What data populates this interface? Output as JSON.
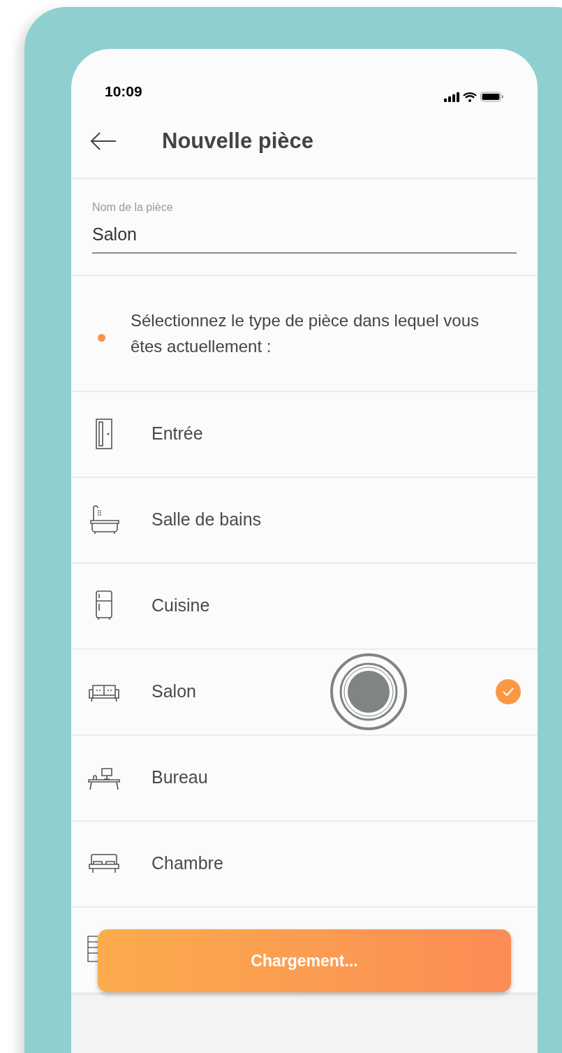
{
  "status_bar": {
    "time": "10:09"
  },
  "header": {
    "title": "Nouvelle pièce"
  },
  "name_field": {
    "label": "Nom de la pièce",
    "value": "Salon"
  },
  "instruction": "Sélectionnez le type de pièce dans lequel vous êtes actuellement :",
  "room_types": [
    {
      "kind": "door",
      "label": "Entrée",
      "selected": false
    },
    {
      "kind": "bathtub",
      "label": "Salle de bains",
      "selected": false
    },
    {
      "kind": "fridge",
      "label": "Cuisine",
      "selected": false
    },
    {
      "kind": "sofa",
      "label": "Salon",
      "selected": true
    },
    {
      "kind": "desk",
      "label": "Bureau",
      "selected": false
    },
    {
      "kind": "bed",
      "label": "Chambre",
      "selected": false
    },
    {
      "kind": "cabinet",
      "selected": false
    }
  ],
  "button": {
    "label": "Chargement..."
  }
}
